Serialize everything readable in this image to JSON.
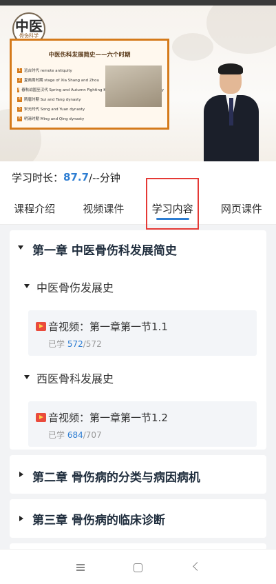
{
  "video": {
    "logo_big": "中医",
    "logo_small": "骨伤科学",
    "slide_title": "中医伤科发展简史——六个时期",
    "slide_items": [
      {
        "num": "1",
        "text": "远古时代 remote antiquity"
      },
      {
        "num": "2",
        "text": "夏商周时期 stage of Xia Shang and Zhou"
      },
      {
        "num": "3",
        "text": "春秋战国至汉代 Spring and Autumn Fighting Kingdoms stage to Han dynasty"
      },
      {
        "num": "4",
        "text": "隋唐时期 Sui and Tang dynasty"
      },
      {
        "num": "5",
        "text": "宋元时代 Song and Yuan dynasty"
      },
      {
        "num": "6",
        "text": "明清时期 Ming and Qing dynasty"
      }
    ]
  },
  "study": {
    "label": "学习时长：",
    "value": "87.7",
    "suffix": "/--分钟"
  },
  "tabs": [
    {
      "label": "课程介绍"
    },
    {
      "label": "视频课件"
    },
    {
      "label": "学习内容"
    },
    {
      "label": "网页课件"
    }
  ],
  "chapters": [
    {
      "title": "第一章 中医骨伤科发展简史",
      "sections": [
        {
          "title": "中医骨伤发展史",
          "lesson": {
            "title": "音视频：第一章第一节1.1",
            "progress_label": "已学",
            "done": "572",
            "total": "/572"
          }
        },
        {
          "title": "西医骨科发展史",
          "lesson": {
            "title": "音视频：第一章第一节1.2",
            "progress_label": "已学",
            "done": "684",
            "total": "/707"
          }
        }
      ]
    },
    {
      "title": "第二章 骨伤病的分类与病因病机"
    },
    {
      "title": "第三章 骨伤病的临床诊断"
    }
  ],
  "colors": {
    "accent": "#2d7dd2",
    "highlight": "#e53935",
    "video_icon": "#ea4b3c"
  }
}
